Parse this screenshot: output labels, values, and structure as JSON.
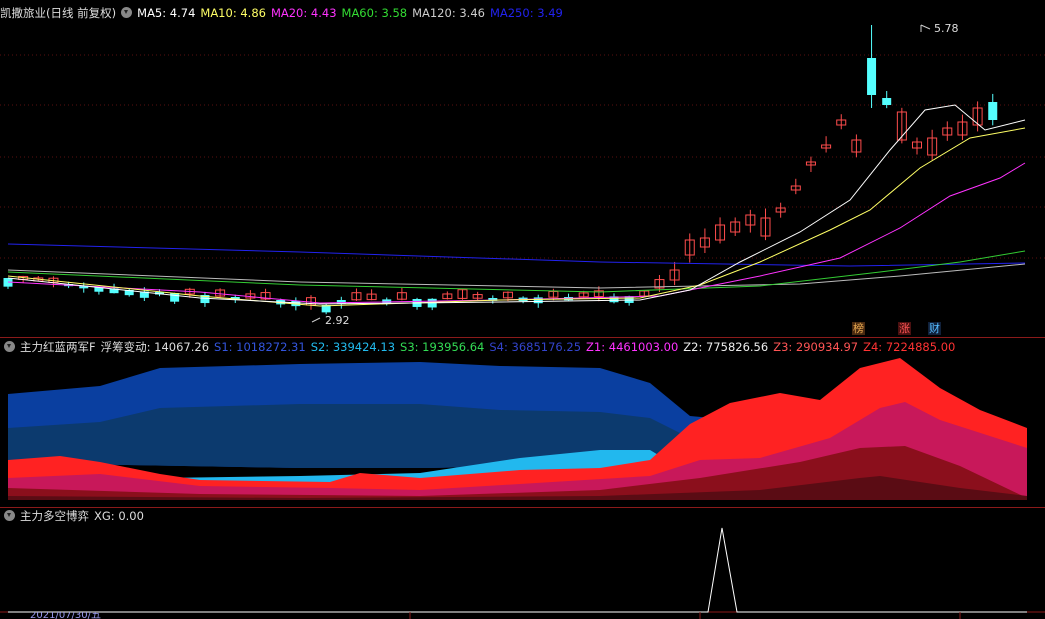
{
  "price_panel": {
    "title": "凯撒旅业(日线 前复权)",
    "ma": [
      {
        "label": "MA5: 4.74",
        "color": "#ffffff"
      },
      {
        "label": "MA10: 4.86",
        "color": "#ffff66"
      },
      {
        "label": "MA20: 4.43",
        "color": "#ff33ff"
      },
      {
        "label": "MA60: 3.58",
        "color": "#33dd33"
      },
      {
        "label": "MA120: 3.46",
        "color": "#cccccc"
      },
      {
        "label": "MA250: 3.49",
        "color": "#2222ee"
      }
    ],
    "high_label": "5.78",
    "low_label": "2.92",
    "badges": [
      {
        "text": "榜",
        "color": "#e6a850",
        "bg": "#4a2a10"
      },
      {
        "text": "涨",
        "color": "#ff5555",
        "bg": "#4a1010"
      },
      {
        "text": "财",
        "color": "#55bbff",
        "bg": "#10203a"
      }
    ]
  },
  "chip_panel": {
    "title": "主力红蓝两军F",
    "items": [
      {
        "label": "浮筹变动: 14067.26",
        "color": "#dddddd"
      },
      {
        "label": "S1: 1018272.31",
        "color": "#3355dd"
      },
      {
        "label": "S2: 339424.13",
        "color": "#22bbee"
      },
      {
        "label": "S3: 193956.64",
        "color": "#33dd55"
      },
      {
        "label": "S4: 3685176.25",
        "color": "#3344cc"
      },
      {
        "label": "Z1: 4461003.00",
        "color": "#ff33ff"
      },
      {
        "label": "Z2: 775826.56",
        "color": "#eeeeee"
      },
      {
        "label": "Z3: 290934.97",
        "color": "#ff5555"
      },
      {
        "label": "Z4: 7224885.00",
        "color": "#ff3333"
      }
    ]
  },
  "xg_panel": {
    "title": "主力多空博弈",
    "value": "XG: 0.00"
  },
  "bottom": {
    "date": "2021/07/30/五"
  }
}
